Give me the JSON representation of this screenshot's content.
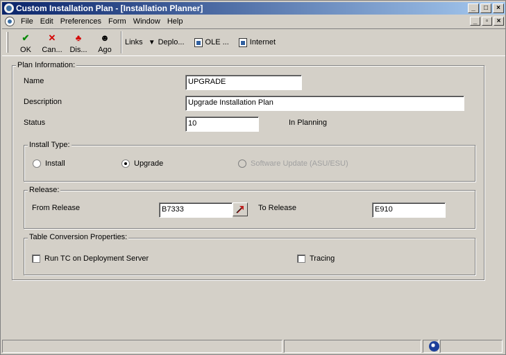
{
  "window": {
    "title": "Custom Installation Plan - [Installation Planner]",
    "controls": [
      "_",
      "□",
      "×"
    ]
  },
  "menu": {
    "items": [
      "File",
      "Edit",
      "Preferences",
      "Form",
      "Window",
      "Help"
    ],
    "mdi_controls": [
      "_",
      "▫",
      "×"
    ]
  },
  "toolbar": {
    "ok_label": "OK",
    "cancel_label": "Can...",
    "delete_label": "Dis...",
    "agent_label": "Ago",
    "links_label": "Links",
    "deploy_label": "Deplo...",
    "ole_label": "OLE ...",
    "internet_label": "Internet"
  },
  "plan_info": {
    "legend": "Plan Information:",
    "name_label": "Name",
    "name_value": "UPGRADE",
    "description_label": "Description",
    "description_value": "Upgrade Installation Plan",
    "status_label": "Status",
    "status_value": "10",
    "status_text": "In Planning"
  },
  "install_type": {
    "legend": "Install Type:",
    "options": [
      {
        "label": "Install",
        "checked": false,
        "disabled": false
      },
      {
        "label": "Upgrade",
        "checked": true,
        "disabled": false
      },
      {
        "label": "Software Update (ASU/ESU)",
        "checked": false,
        "disabled": true
      }
    ]
  },
  "release": {
    "legend": "Release:",
    "from_label": "From Release",
    "from_value": "B7333",
    "to_label": "To Release",
    "to_value": "E910"
  },
  "table_conversion": {
    "legend": "Table Conversion Properties:",
    "run_tc_label": "Run TC on Deployment Server",
    "run_tc_checked": false,
    "tracing_label": "Tracing",
    "tracing_checked": false
  },
  "colors": {
    "window_bg": "#d4d0c8",
    "title_start": "#0a246a",
    "title_end": "#a6caf0"
  }
}
